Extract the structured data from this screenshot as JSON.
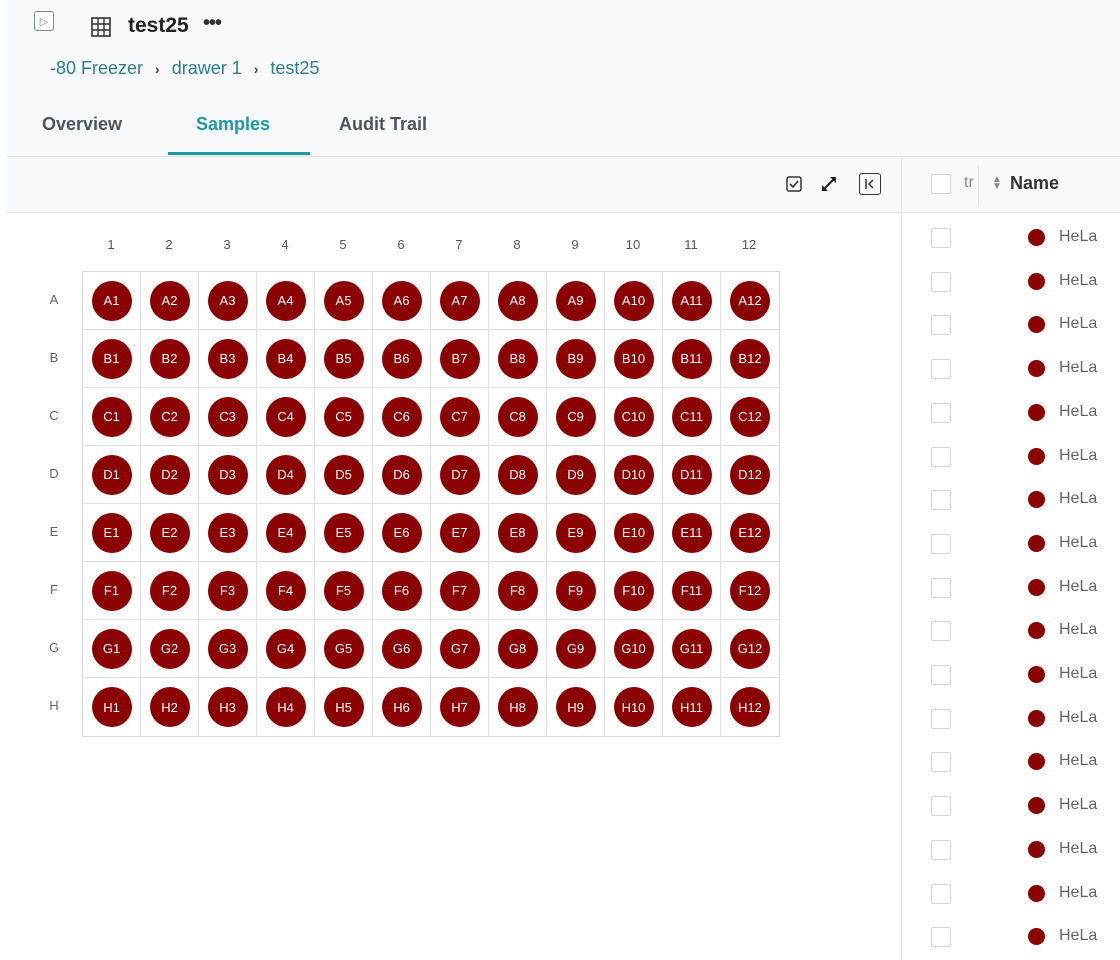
{
  "header": {
    "title": "test25",
    "more_label": "•••",
    "breadcrumb": [
      "-80 Freezer",
      "drawer 1",
      "test25"
    ]
  },
  "tabs": [
    {
      "label": "Overview",
      "active": false
    },
    {
      "label": "Samples",
      "active": true
    },
    {
      "label": "Audit Trail",
      "active": false
    }
  ],
  "toolbar": {
    "icons": [
      "checkbox-select-icon",
      "expand-arrows-icon",
      "collapse-panel-icon"
    ]
  },
  "plate": {
    "columns": [
      "1",
      "2",
      "3",
      "4",
      "5",
      "6",
      "7",
      "8",
      "9",
      "10",
      "11",
      "12"
    ],
    "rows": [
      "A",
      "B",
      "C",
      "D",
      "E",
      "F",
      "G",
      "H"
    ],
    "well_color": "#8b0000"
  },
  "table": {
    "truncated_header": "tr",
    "name_header": "Name",
    "rows": [
      "HeLa",
      "HeLa",
      "HeLa",
      "HeLa",
      "HeLa",
      "HeLa",
      "HeLa",
      "HeLa",
      "HeLa",
      "HeLa",
      "HeLa",
      "HeLa",
      "HeLa",
      "HeLa",
      "HeLa",
      "HeLa",
      "HeLa"
    ]
  },
  "colors": {
    "accent": "#1d9aa6",
    "link": "#2e7d8c",
    "sample": "#8b0000"
  }
}
